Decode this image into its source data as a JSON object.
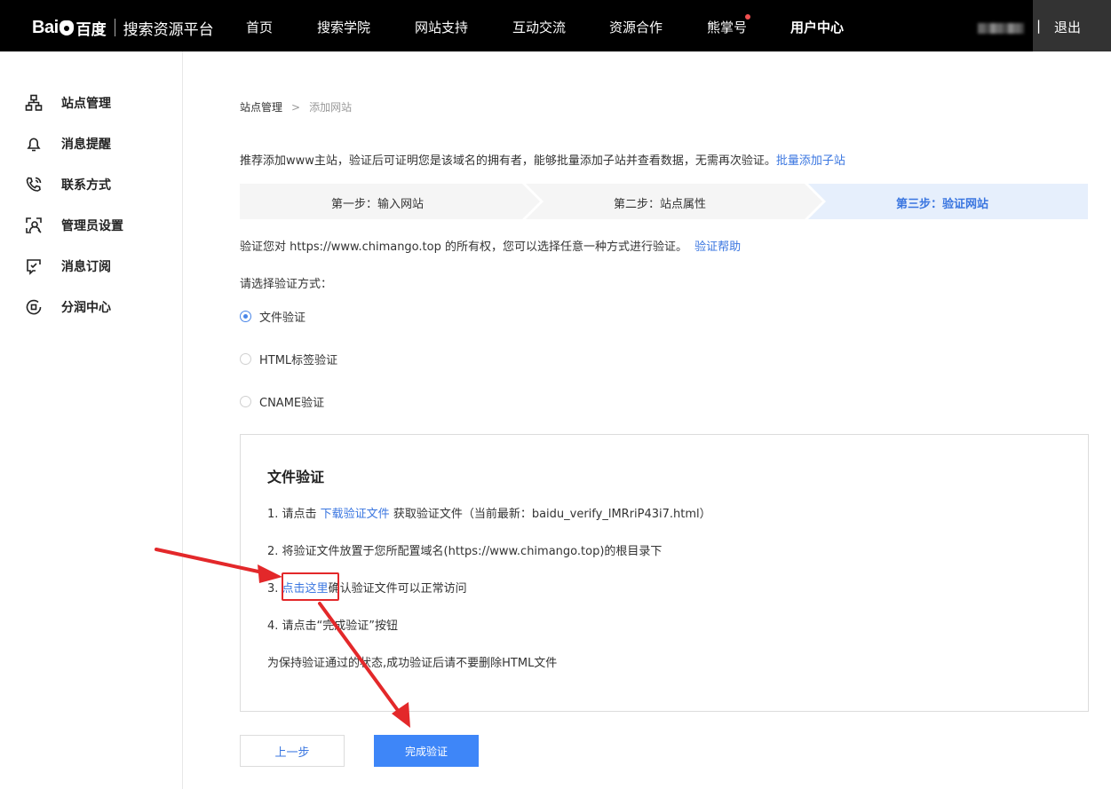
{
  "header": {
    "logo_text": "Bai",
    "logo_text_2": "百度",
    "platform": "搜索资源平台",
    "nav": [
      "首页",
      "搜索学院",
      "网站支持",
      "互动交流",
      "资源合作",
      "熊掌号",
      "用户中心"
    ],
    "active_nav": "用户中心",
    "separator": "|",
    "logout": "退出"
  },
  "sidebar": {
    "items": [
      {
        "label": "站点管理",
        "icon": "sitemap-icon"
      },
      {
        "label": "消息提醒",
        "icon": "bell-icon"
      },
      {
        "label": "联系方式",
        "icon": "phone-icon"
      },
      {
        "label": "管理员设置",
        "icon": "admin-icon"
      },
      {
        "label": "消息订阅",
        "icon": "subscribe-icon"
      },
      {
        "label": "分润中心",
        "icon": "revenue-icon"
      }
    ]
  },
  "breadcrumb": {
    "root": "站点管理",
    "separator": ">",
    "current": "添加网站"
  },
  "tip": {
    "text": "推荐添加www主站，验证后可证明您是该域名的拥有者，能够批量添加子站并查看数据，无需再次验证。",
    "link": "批量添加子站"
  },
  "steps": [
    "第一步：输入网站",
    "第二步：站点属性",
    "第三步：验证网站"
  ],
  "verify": {
    "text": "验证您对 https://www.chimango.top 的所有权，您可以选择任意一种方式进行验证。",
    "help_link": "验证帮助"
  },
  "choose_label": "请选择验证方式：",
  "methods": [
    {
      "label": "文件验证",
      "selected": true
    },
    {
      "label": "HTML标签验证",
      "selected": false
    },
    {
      "label": "CNAME验证",
      "selected": false
    }
  ],
  "panel": {
    "title": "文件验证",
    "line1_pre": "1.  请点击 ",
    "line1_link": "下载验证文件",
    "line1_post": " 获取验证文件（当前最新：baidu_verify_lMRriP43i7.html）",
    "line2": "2.  将验证文件放置于您所配置域名(https://www.chimango.top)的根目录下",
    "line3_pre": "3. ",
    "line3_link": "点击这里",
    "line3_post": "确认验证文件可以正常访问",
    "line4": "4.  请点击“完成验证”按钮",
    "note": "为保持验证通过的状态,成功验证后请不要删除HTML文件"
  },
  "buttons": {
    "prev": "上一步",
    "done": "完成验证"
  },
  "colors": {
    "link": "#3a76e0",
    "primary": "#3e86f8",
    "annotation": "#e3282a",
    "step_active_bg": "#e6effc"
  }
}
